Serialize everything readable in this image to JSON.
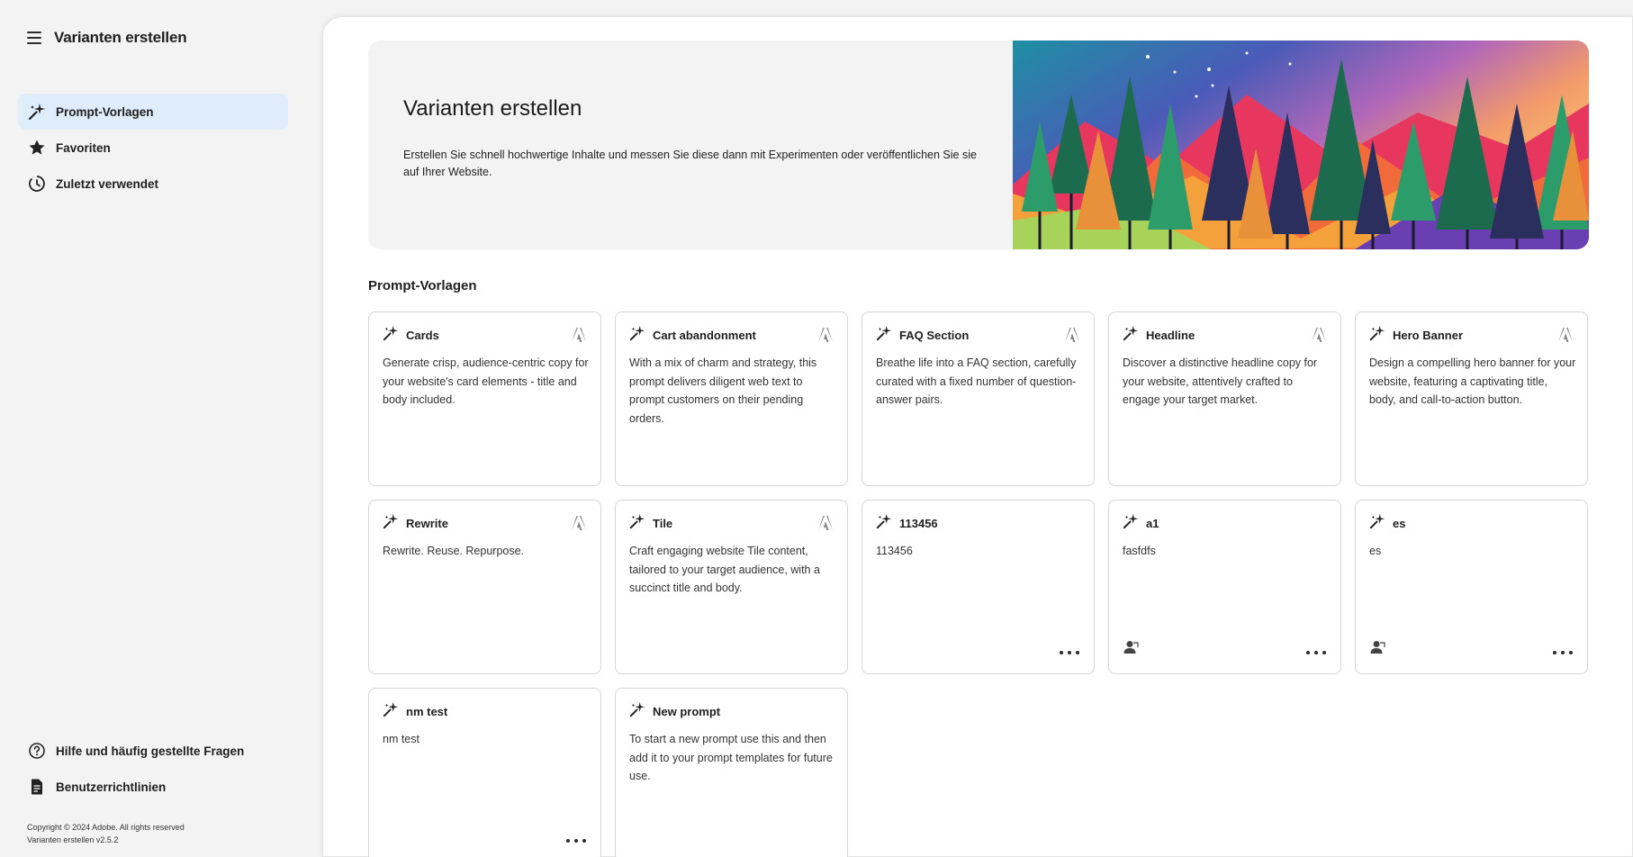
{
  "app": {
    "title": "Varianten erstellen"
  },
  "sidebar": {
    "items": [
      {
        "label": "Prompt-Vorlagen",
        "icon": "sparkle-icon",
        "active": true
      },
      {
        "label": "Favoriten",
        "icon": "star-icon",
        "active": false
      },
      {
        "label": "Zuletzt verwendet",
        "icon": "history-icon",
        "active": false
      }
    ],
    "footer_items": [
      {
        "label": "Hilfe und häufig gestellte Fragen",
        "icon": "help-icon"
      },
      {
        "label": "Benutzerrichtlinien",
        "icon": "document-icon"
      }
    ],
    "copyright": "Copyright © 2024 Adobe. All rights reserved",
    "version": "Varianten erstellen v2.5.2"
  },
  "hero": {
    "title": "Varianten erstellen",
    "description": "Erstellen Sie schnell hochwertige Inhalte und messen Sie diese dann mit Experimenten oder veröffentlichen Sie sie auf Ihrer Website."
  },
  "section": {
    "title": "Prompt-Vorlagen"
  },
  "cards": [
    {
      "title": "Cards",
      "desc": "Generate crisp, audience-centric copy for your website's card elements - title and body included.",
      "adobe": true,
      "user": false,
      "more": false
    },
    {
      "title": "Cart abandonment",
      "desc": "With a mix of charm and strategy, this prompt delivers diligent web text to prompt customers on their pending orders.",
      "adobe": true,
      "user": false,
      "more": false
    },
    {
      "title": "FAQ Section",
      "desc": "Breathe life into a FAQ section, carefully curated with a fixed number of question-answer pairs.",
      "adobe": true,
      "user": false,
      "more": false
    },
    {
      "title": "Headline",
      "desc": "Discover a distinctive headline copy for your website, attentively crafted to engage your target market.",
      "adobe": true,
      "user": false,
      "more": false
    },
    {
      "title": "Hero Banner",
      "desc": "Design a compelling hero banner for your website, featuring a captivating title, body, and call-to-action button.",
      "adobe": true,
      "user": false,
      "more": false
    },
    {
      "title": "Rewrite",
      "desc": "Rewrite. Reuse. Repurpose.",
      "adobe": true,
      "user": false,
      "more": false
    },
    {
      "title": "Tile",
      "desc": "Craft engaging website Tile content, tailored to your target audience, with a succinct title and body.",
      "adobe": true,
      "user": false,
      "more": false
    },
    {
      "title": "113456",
      "desc": "113456",
      "adobe": false,
      "user": false,
      "more": true
    },
    {
      "title": "a1",
      "desc": "fasfdfs",
      "adobe": false,
      "user": true,
      "more": true
    },
    {
      "title": "es",
      "desc": "es",
      "adobe": false,
      "user": true,
      "more": true
    },
    {
      "title": "nm test",
      "desc": "nm test",
      "adobe": false,
      "user": false,
      "more": true
    },
    {
      "title": "New prompt",
      "desc": "To start a new prompt use this and then add it to your prompt templates for future use.",
      "adobe": false,
      "user": false,
      "more": false
    }
  ],
  "colors": {
    "active_nav": "#dfedfb",
    "background": "#f3f3f3",
    "card_border": "#d6d6d6"
  }
}
